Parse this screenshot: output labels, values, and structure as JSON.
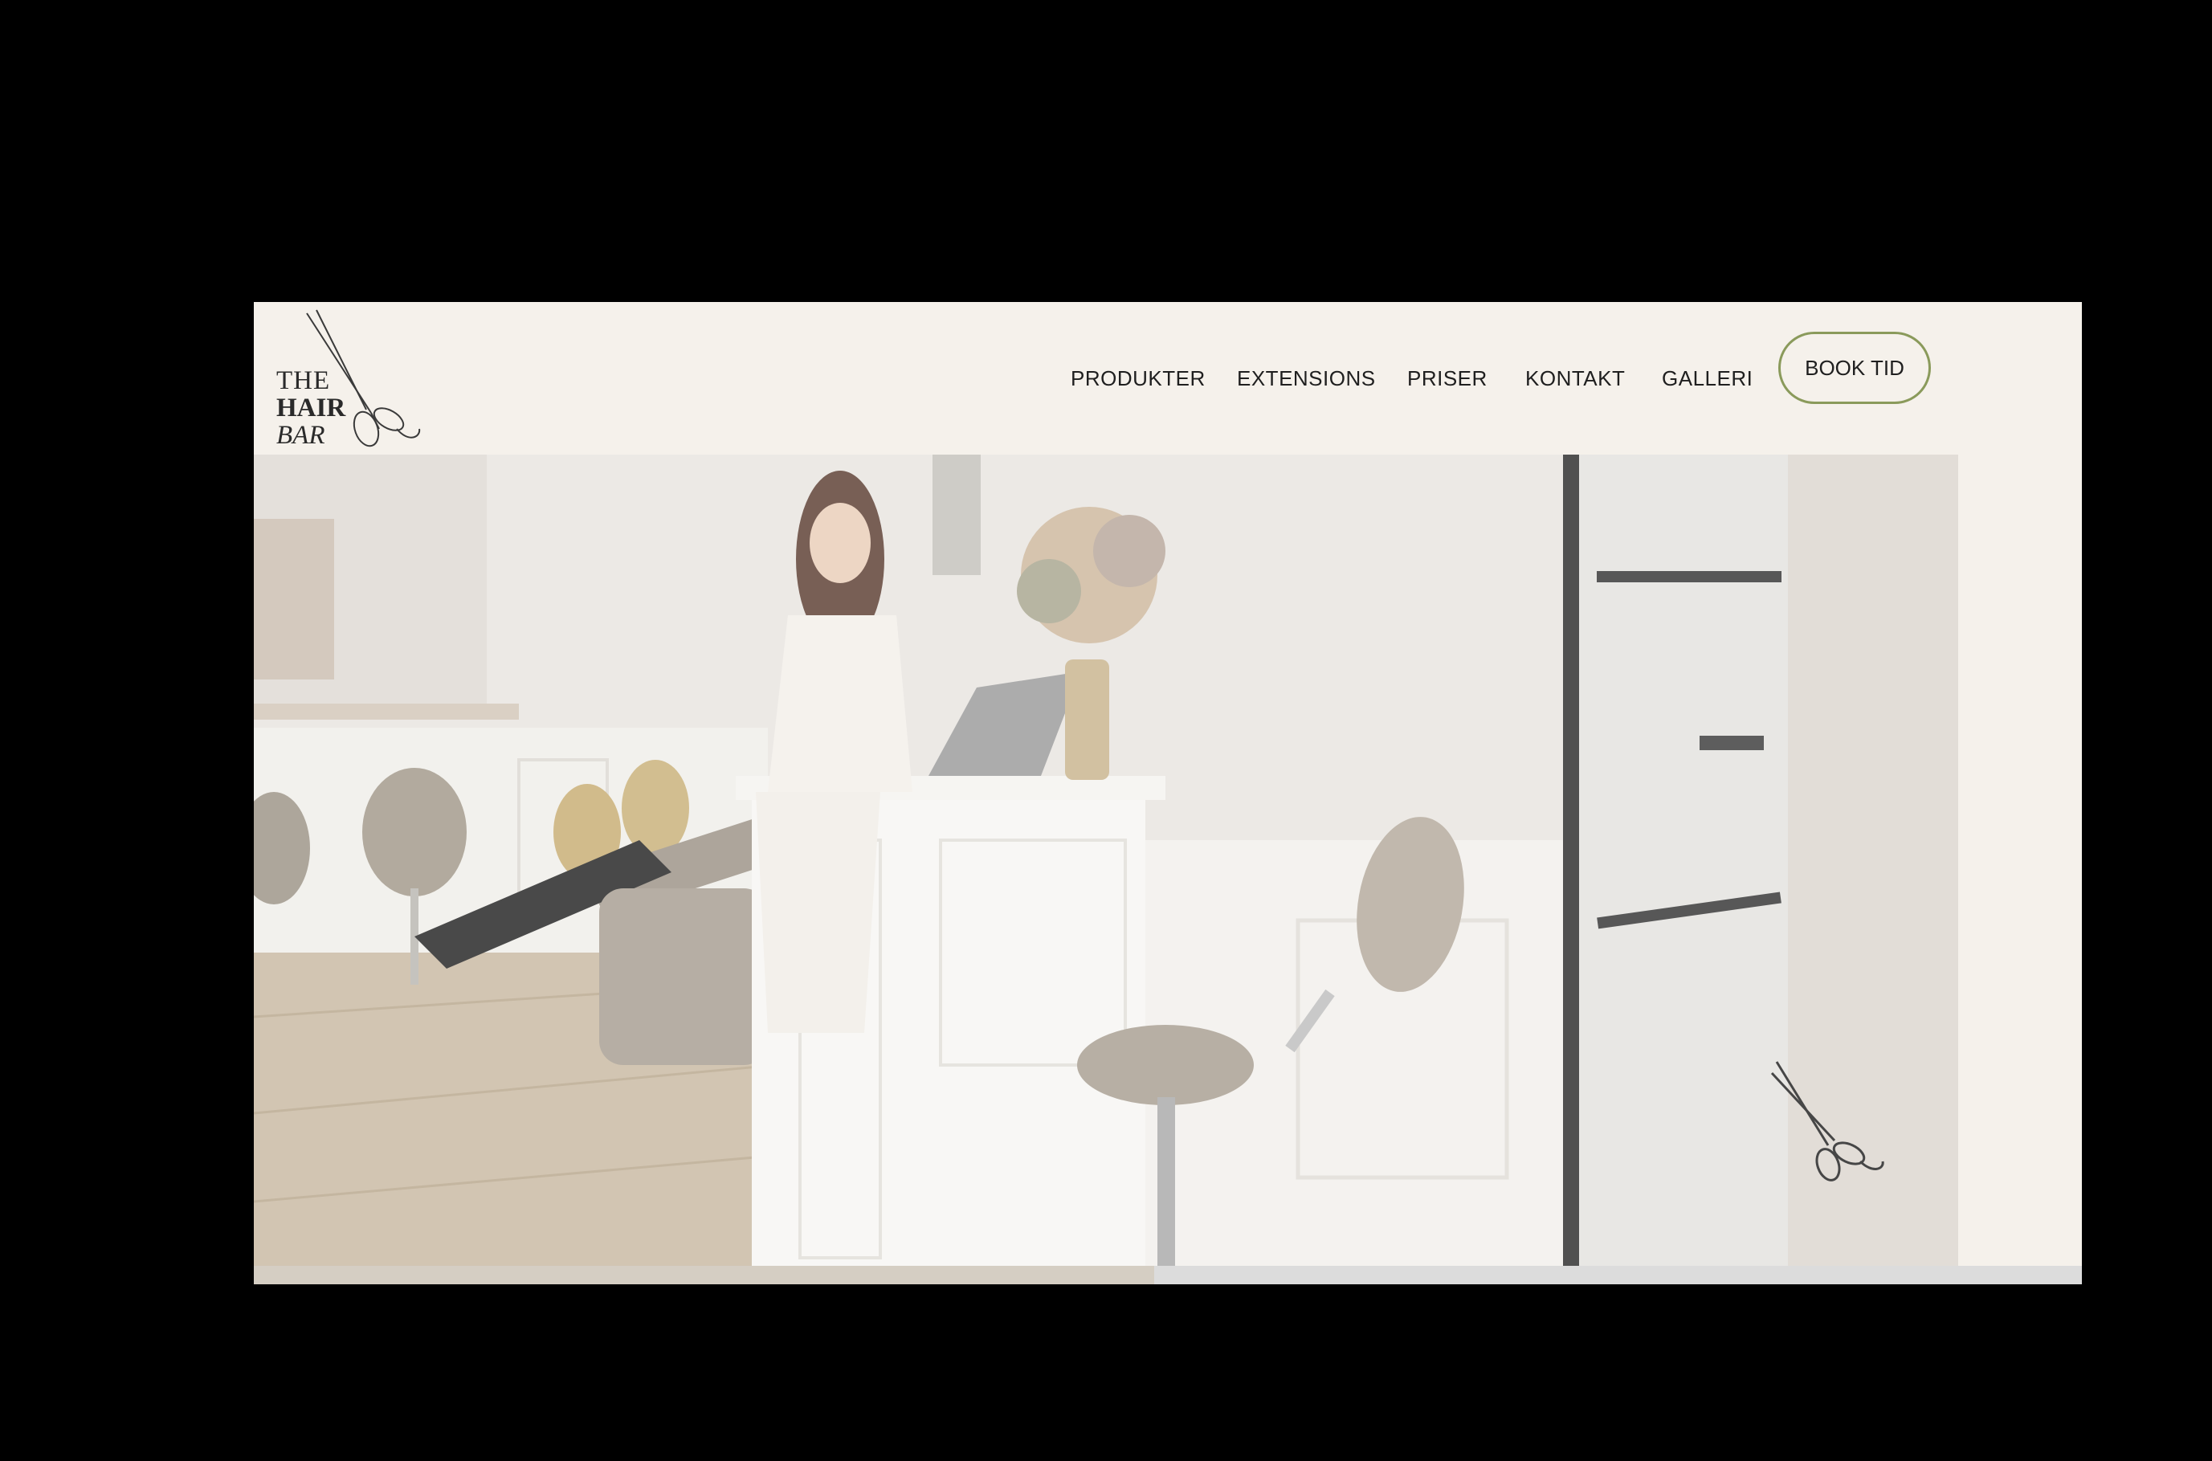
{
  "brand": {
    "line1": "THE",
    "line2": "HAIR",
    "line3": "BAR",
    "logo_icon": "scissors-icon"
  },
  "nav": {
    "items": [
      {
        "label": "PRODUKTER"
      },
      {
        "label": "EXTENSIONS"
      },
      {
        "label": "PRISER"
      },
      {
        "label": "KONTAKT"
      },
      {
        "label": "GALLERI"
      }
    ],
    "cta_label": "BOOK TID"
  },
  "hero": {
    "image_icon": "salon-photo",
    "decor_icon": "scissors-icon"
  },
  "colors": {
    "page_bg": "#000000",
    "header_bg": "#f5f1eb",
    "accent_border": "#8a9a5b",
    "text": "#1f1f1f"
  }
}
